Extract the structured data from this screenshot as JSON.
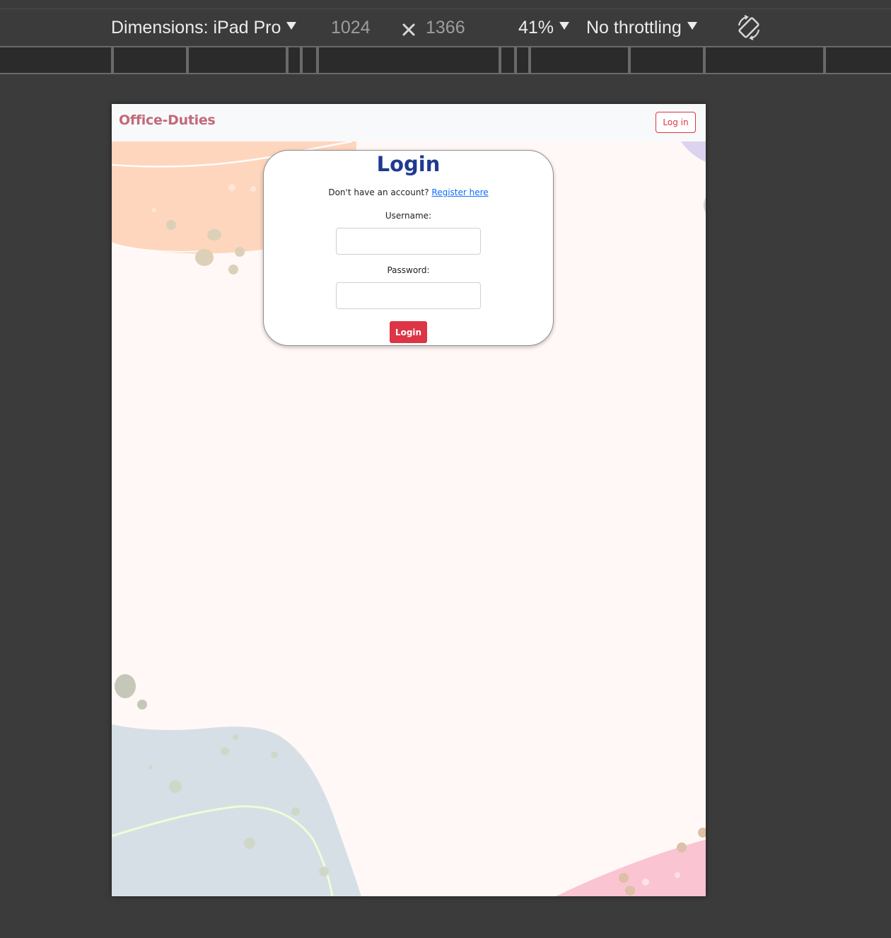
{
  "devtools": {
    "dimensions_label": "Dimensions: iPad Pro",
    "width_value": "1024",
    "height_value": "1366",
    "zoom_label": "41%",
    "throttling_label": "No throttling",
    "icons": {
      "dimensions_dropdown": "caret-down-icon",
      "dimension_separator": "times-icon",
      "rotate": "rotate-icon"
    }
  },
  "page": {
    "navbar": {
      "brand": "Office-Duties",
      "login_button": "Log in"
    },
    "login_card": {
      "title": "Login",
      "register_prompt": "Don't have an account?",
      "register_link": "Register here",
      "username_label": "Username:",
      "username_value": "",
      "password_label": "Password:",
      "password_value": "",
      "submit_label": "Login"
    }
  },
  "colors": {
    "brand": "#c06a7a",
    "title": "#203a8f",
    "danger": "#dc3545",
    "link": "#0d6efd",
    "page_background": "#fff8f6"
  }
}
